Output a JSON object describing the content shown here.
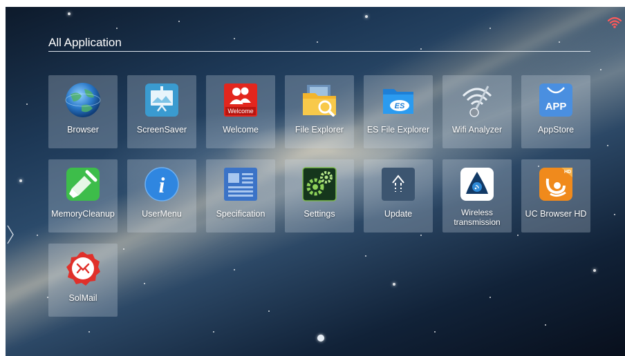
{
  "header": {
    "title": "All Application"
  },
  "status": {
    "wifi_icon": "wifi-icon"
  },
  "apps": [
    {
      "label": "Browser",
      "icon": "globe-icon"
    },
    {
      "label": "ScreenSaver",
      "icon": "screensaver-icon"
    },
    {
      "label": "Welcome",
      "icon": "welcome-icon",
      "badge": "Welcome"
    },
    {
      "label": "File Explorer",
      "icon": "folder-icon"
    },
    {
      "label": "ES File Explorer",
      "icon": "es-folder-icon",
      "badge": "ES"
    },
    {
      "label": "Wifi Analyzer",
      "icon": "wifi-analyzer-icon"
    },
    {
      "label": "AppStore",
      "icon": "appstore-icon",
      "badge": "APP"
    },
    {
      "label": "MemoryCleanup",
      "icon": "broom-icon"
    },
    {
      "label": "UserMenu",
      "icon": "info-icon",
      "badge": "i"
    },
    {
      "label": "Specification",
      "icon": "document-icon"
    },
    {
      "label": "Settings",
      "icon": "gears-icon"
    },
    {
      "label": "Update",
      "icon": "update-arrow-icon"
    },
    {
      "label": "Wireless transmission",
      "icon": "cast-icon"
    },
    {
      "label": "UC Browser HD",
      "icon": "uc-browser-icon",
      "badge": "HD"
    },
    {
      "label": "SolMail",
      "icon": "mail-icon"
    }
  ],
  "pager": {
    "current_page": 1
  },
  "colors": {
    "title_text": "#ffffff",
    "tile_bg": "rgba(205,215,228,0.28)",
    "welcome_red": "#e3261d",
    "appstore_blue": "#4a8fe0",
    "memory_green": "#3dbd4a",
    "uc_orange": "#f08a1c",
    "solmail_red": "#e0302a"
  }
}
